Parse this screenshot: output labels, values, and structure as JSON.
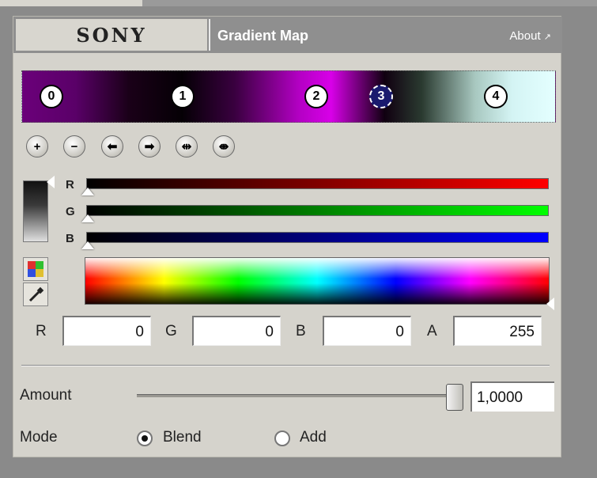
{
  "header": {
    "brand": "SONY",
    "title": "Gradient Map",
    "about": "About"
  },
  "gradient": {
    "stops": [
      "0",
      "1",
      "2",
      "3",
      "4"
    ],
    "selected_stop": "3"
  },
  "toolbar": {
    "buttons": [
      {
        "name": "add-stop-icon",
        "glyph": "+"
      },
      {
        "name": "remove-stop-icon",
        "glyph": "−"
      },
      {
        "name": "move-stop-left-icon",
        "glyph": "⬅"
      },
      {
        "name": "move-stop-right-icon",
        "glyph": "➡"
      },
      {
        "name": "distribute-icon",
        "glyph": "⇹"
      },
      {
        "name": "distribute-evenly-icon",
        "glyph": "⇼"
      }
    ]
  },
  "channels": {
    "r_label": "R",
    "g_label": "G",
    "b_label": "B"
  },
  "fields": {
    "r_label": "R",
    "r_value": "0",
    "g_label": "G",
    "g_value": "0",
    "b_label": "B",
    "b_value": "0",
    "a_label": "A",
    "a_value": "255"
  },
  "amount": {
    "label": "Amount",
    "value": "1,0000",
    "level": 1.0
  },
  "mode": {
    "label": "Mode",
    "options": [
      "Blend",
      "Add"
    ],
    "selected": "Blend"
  }
}
